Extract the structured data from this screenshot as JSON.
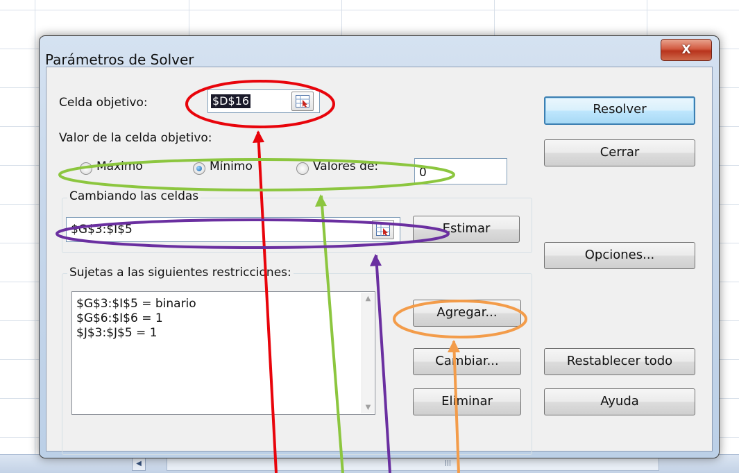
{
  "dialog": {
    "title": "Parámetros de Solver",
    "close_label": "X"
  },
  "target": {
    "label": "Celda objetivo:",
    "value": "$D$16"
  },
  "value_of": {
    "label": "Valor de la celda objetivo:",
    "options": [
      {
        "label": "Máximo",
        "checked": false
      },
      {
        "label": "Mínimo",
        "checked": true
      },
      {
        "label": "Valores de:",
        "checked": false
      }
    ],
    "value_field": "0"
  },
  "changing": {
    "legend": "Cambiando las celdas",
    "value": "$G$3:$I$5",
    "estimate_label": "Estimar"
  },
  "constraints": {
    "legend": "Sujetas a las siguientes restricciones:",
    "items": [
      "$G$3:$I$5 = binario",
      "$G$6:$I$6 = 1",
      "$J$3:$J$5 = 1"
    ],
    "add_label": "Agregar...",
    "change_label": "Cambiar...",
    "delete_label": "Eliminar"
  },
  "side_buttons": {
    "solve": "Resolver",
    "close": "Cerrar",
    "options": "Opciones...",
    "reset": "Restablecer todo",
    "help": "Ayuda"
  },
  "colors": {
    "target_mark": "#e8040b",
    "value_mark": "#8cc63f",
    "changing_mark": "#6a2fa0",
    "add_mark": "#f39c4a"
  }
}
